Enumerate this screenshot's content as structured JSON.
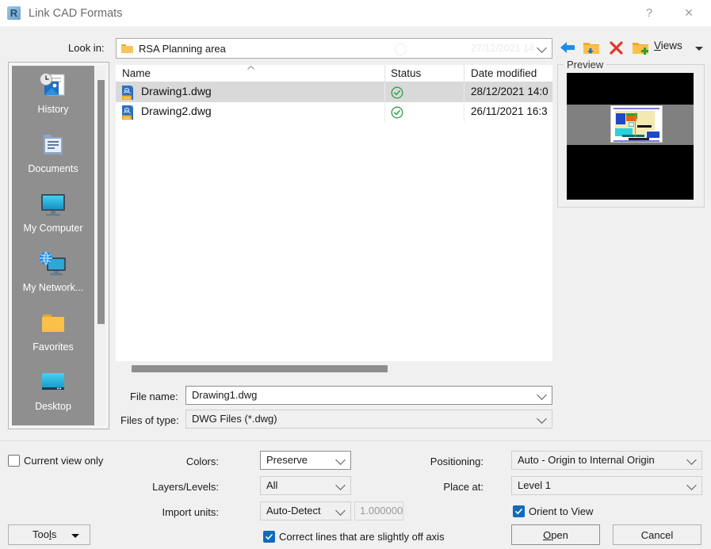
{
  "window": {
    "title": "Link CAD Formats",
    "logo_text": "R",
    "help_label": "?",
    "close_label": "×"
  },
  "lookin": {
    "label": "Look in:",
    "value": "RSA Planning area",
    "ghost_text": "27/12/2021 14",
    "folder_icon": "folder-icon",
    "chevron_icon": "chevron-down-icon"
  },
  "toolbar": {
    "back_icon": "back-arrow-icon",
    "up_icon": "up-one-level-folder-icon",
    "delete_icon": "delete-x-icon",
    "new_folder_icon": "new-folder-icon",
    "views_label": "Views",
    "views_accel": "V",
    "views_rest": "iews",
    "views_arrow_icon": "dropdown-arrow-icon"
  },
  "preview": {
    "label": "Preview",
    "thumbnail_name": "cad-drawing-thumbnail"
  },
  "places": {
    "items": [
      {
        "label": "History",
        "icon": "history-icon"
      },
      {
        "label": "Documents",
        "icon": "documents-folder-icon"
      },
      {
        "label": "My Computer",
        "icon": "monitor-icon"
      },
      {
        "label": "My Network...",
        "icon": "network-globe-icon"
      },
      {
        "label": "Favorites",
        "icon": "favorites-folder-icon"
      },
      {
        "label": "Desktop",
        "icon": "desktop-icon"
      }
    ]
  },
  "filelist": {
    "columns": [
      "Name",
      "Status",
      "Date modified"
    ],
    "sort_icon": "sort-ascending-icon",
    "rows": [
      {
        "name": "Drawing1.dwg",
        "status_icon": "available-check-icon",
        "date": "28/12/2021 14:0",
        "selected": true,
        "file_icon": "dwg-file-icon"
      },
      {
        "name": "Drawing2.dwg",
        "status_icon": "available-check-icon",
        "date": "26/11/2021 16:3",
        "selected": false,
        "file_icon": "dwg-file-icon"
      }
    ]
  },
  "filename": {
    "label": "File name:",
    "value": "Drawing1.dwg"
  },
  "filetype": {
    "label": "Files of type:",
    "value": "DWG Files  (*.dwg)"
  },
  "options": {
    "current_view_only": {
      "label": "Current view only",
      "checked": false
    },
    "colors": {
      "label": "Colors:",
      "value": "Preserve"
    },
    "layers": {
      "label": "Layers/Levels:",
      "value": "All"
    },
    "import_units": {
      "label": "Import units:",
      "value": "Auto-Detect"
    },
    "scale": {
      "value": "1.000000"
    },
    "correct_lines": {
      "label": "Correct lines that are slightly off axis",
      "checked": true
    },
    "positioning": {
      "label": "Positioning:",
      "value": "Auto - Origin to Internal Origin"
    },
    "place_at": {
      "label": "Place at:",
      "value": "Level 1"
    },
    "orient_to_view": {
      "label": "Orient to View",
      "checked": true
    }
  },
  "buttons": {
    "tools": {
      "label_before": "Too",
      "accel": "l",
      "label_after": "s"
    },
    "open": {
      "accel": "O",
      "rest": "pen"
    },
    "cancel": {
      "label": "Cancel"
    }
  },
  "colors": {
    "accent": "#0f6cbd",
    "selection": "#d9d9d9",
    "places_bg": "#8f8f8f",
    "status_green": "#2e9e4f"
  }
}
